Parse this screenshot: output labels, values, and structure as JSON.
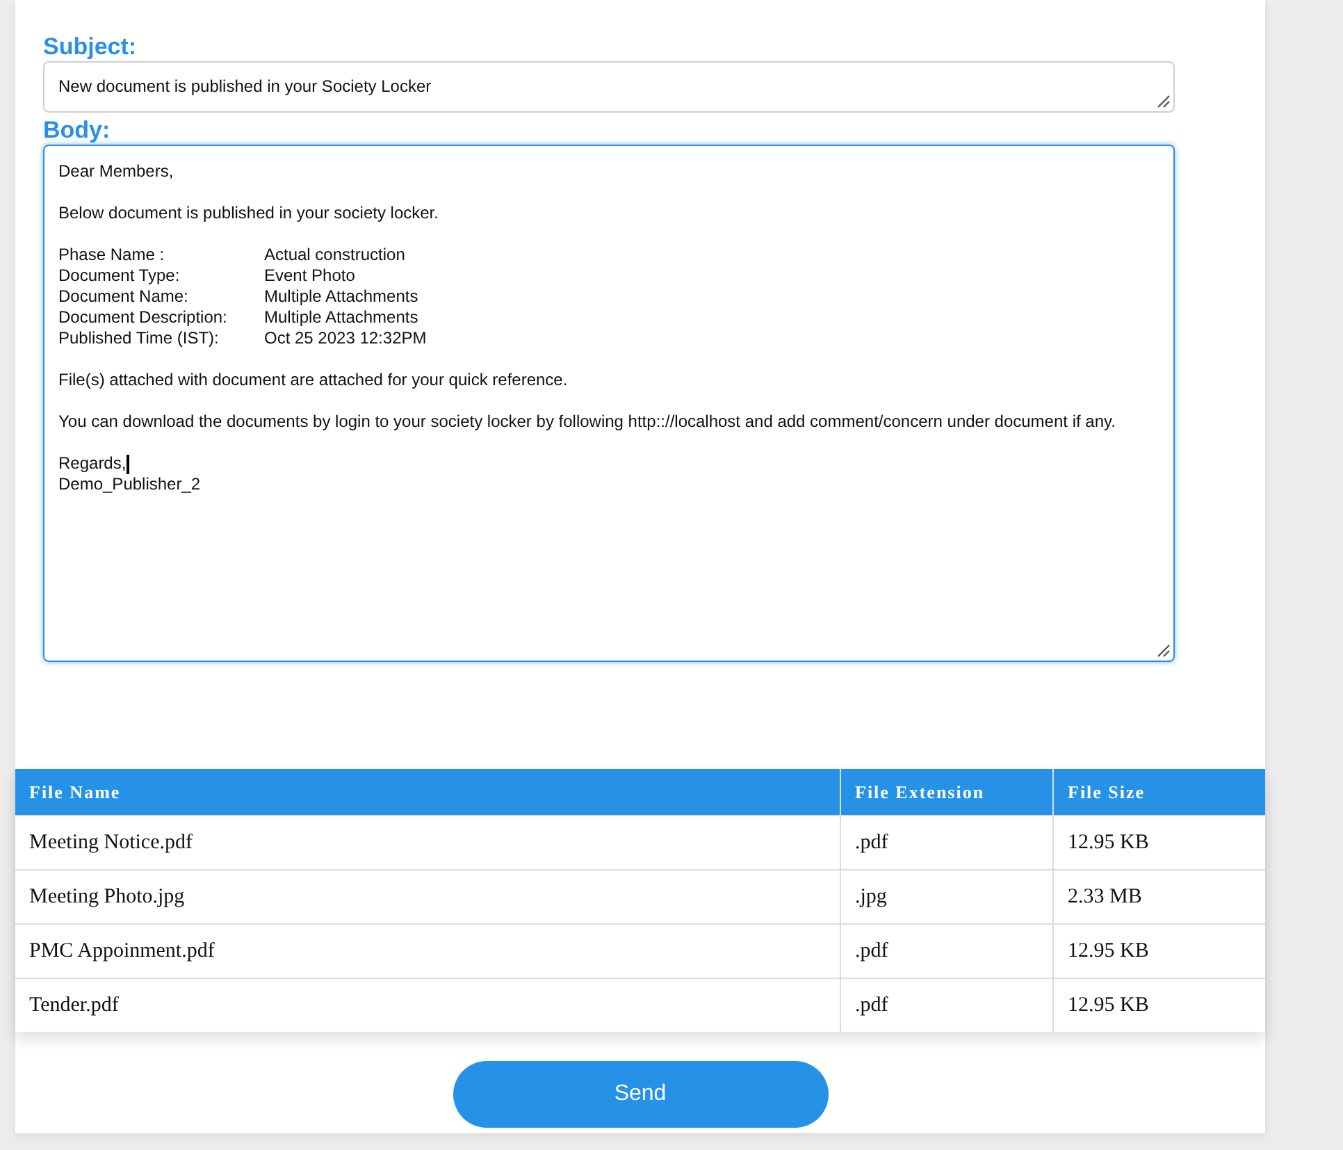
{
  "subject": {
    "label": "Subject:",
    "value": "New document is published in your Society Locker"
  },
  "body": {
    "label": "Body:",
    "focused": true,
    "greeting": "Dear Members,",
    "intro": "Below document is published in your society locker.",
    "details": [
      {
        "label": "Phase Name :",
        "value": "Actual construction"
      },
      {
        "label": "Document Type:",
        "value": "Event Photo"
      },
      {
        "label": "Document Name:",
        "value": "Multiple Attachments"
      },
      {
        "label": "Document Description:",
        "value": "Multiple Attachments"
      },
      {
        "label": "Published Time (IST):",
        "value": "Oct 25 2023 12:32PM"
      }
    ],
    "note": "File(s) attached with document are attached for your quick reference.",
    "instruction": "You can download the documents by login to your society locker by following http:://localhost and add comment/concern under document if any.",
    "closing": [
      "Regards,",
      "Demo_Publisher_2"
    ]
  },
  "table": {
    "columns": [
      "File Name",
      "File Extension",
      "File Size"
    ],
    "rows": [
      [
        "Meeting Notice.pdf",
        ".pdf",
        "12.95 KB"
      ],
      [
        "Meeting Photo.jpg",
        ".jpg",
        "2.33 MB"
      ],
      [
        "PMC Appoinment.pdf",
        ".pdf",
        "12.95 KB"
      ],
      [
        "Tender.pdf",
        ".pdf",
        "12.95 KB"
      ]
    ]
  },
  "send_button": "Send"
}
